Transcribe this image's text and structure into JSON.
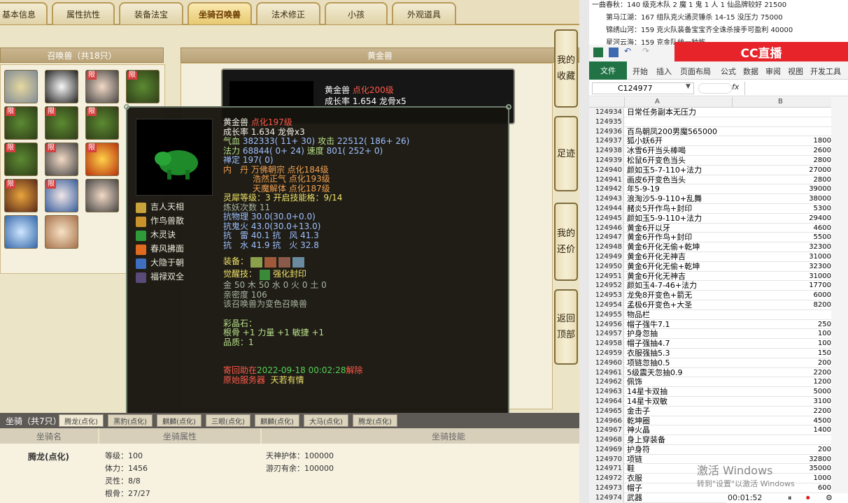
{
  "game": {
    "tabs": [
      "基本信息",
      "属性抗性",
      "装备法宝",
      "坐骑召唤兽",
      "法术修正",
      "小孩",
      "外观道具"
    ],
    "summon_list_title": "召唤兽（共18只）",
    "limited_badge": "限",
    "detail_title": "黄金兽",
    "card": {
      "name": "黄金兽",
      "level": "点化200级",
      "growth": "成长率 1.654 龙骨x5"
    },
    "popup": {
      "name": "黄金兽",
      "level": "点化197级",
      "growth": "成长率 1.634 龙骨x3",
      "hp_label": "气血",
      "hp": "382333( 11+ 30)",
      "atk_label": "攻击",
      "atk": "22512( 186+ 26)",
      "mp_label": "法力",
      "mp": "68844( 0+ 24)",
      "spd_label": "速度",
      "spd": "801( 252+ 0)",
      "zen": "禅定 197( 0)",
      "pill_label": "内　丹",
      "pills": [
        "万佛朝宗 点化184级",
        "浩然正气 点化193级",
        "天魔解体 点化187级"
      ],
      "lingxi": "灵犀等级：3 开启技能格：9/14",
      "lianyao": "炼妖次数 11",
      "res_physical": "抗物理 30.0(30.0+0.0)",
      "res_ghost": "抗鬼火 43.0(30.0+13.0)",
      "res_row1": "抗　雷 40.1 抗　风 41.3",
      "res_row2": "抗　水 41.9 抗　火 32.8",
      "equip_label": "装备：",
      "awaken_label": "觉醒技：",
      "awaken_skill": "强化封印",
      "elements": "金 50 木 50 水 0 火 0 土 0",
      "intimacy": "亲密度 106",
      "variant_note": "该召唤兽为变色召唤兽",
      "gem_label": "彩晶石：",
      "gem_values": "根骨 +1 力量 +1 敏捷 +1",
      "quality": "品质：1",
      "trade_prefix": "寄回助在",
      "trade_time": "2022-09-18 00:02:28",
      "trade_suffix": "解除",
      "server_label": "原始服务器",
      "server_name": "天若有情",
      "skills": [
        "吉人天相",
        "作鸟兽散",
        "木灵诀",
        "春风拂面",
        "大隐于朝",
        "福禄双全"
      ]
    },
    "side_buttons": [
      "我的收藏",
      "足迹",
      "我的还价",
      "返回顶部"
    ],
    "mount_title": "坐骑（共7只）",
    "mount_subtabs": [
      "腾龙(点化)",
      "黑豹(点化)",
      "麒麟(点化)",
      "三眼(点化)",
      "麒麟(点化)",
      "大马(点化)",
      "腾龙(点化)"
    ],
    "mount_headers": [
      "坐骑名",
      "坐骑属性",
      "坐骑技能"
    ],
    "mount": {
      "name": "腾龙(点化)",
      "stats": [
        "等级：100",
        "体力：1456",
        "灵性：8/8",
        "根骨：27/27"
      ],
      "skills": [
        "天神护体：100000",
        "游刃有余：100000"
      ]
    }
  },
  "excel": {
    "notes": [
      "一曲春秋：140 级克木队 2 魔 1 鬼 1 人 1 仙品牌较好 21500",
      "第马江湖：167 组队克火通灵锤杀 14-15 没压力 75000",
      "锦绣山河：159 克火队装备宝宝齐全诛杀接手可盈利 40000",
      "星河云海：159 克金队统一种族"
    ],
    "watermark": "CC直播",
    "ribbon_tabs": [
      "文件",
      "开始",
      "插入",
      "页面布局",
      "公式",
      "数据",
      "审阅",
      "视图",
      "开发工具"
    ],
    "name_box": "C124977",
    "fx": "fx",
    "col_a": "A",
    "col_b": "B",
    "rows": [
      [
        "124934",
        "日常任务副本无压力",
        ""
      ],
      [
        "124935",
        "",
        ""
      ],
      [
        "124936",
        "百鸟朝凤200男魔565000",
        ""
      ],
      [
        "124937",
        "狐小妖6开",
        "1800"
      ],
      [
        "124938",
        "冰雪6开当头棒喝",
        "2600"
      ],
      [
        "124939",
        "松鼠6开变色当头",
        "2800"
      ],
      [
        "124940",
        "颜如玉5-7-110+法力",
        "27000"
      ],
      [
        "124941",
        "画皮6开变色当头",
        "2800"
      ],
      [
        "124942",
        "年5-9-19",
        "39000"
      ],
      [
        "124943",
        "浪淘沙5-9-110+乱舞",
        "38000"
      ],
      [
        "124944",
        "赭炎5开作鸟+封印",
        "5300"
      ],
      [
        "124945",
        "颜如玉5-9-110+法力",
        "29400"
      ],
      [
        "124946",
        "黄金6开以牙",
        "4600"
      ],
      [
        "124947",
        "黄金6开作鸟+封印",
        "5500"
      ],
      [
        "124948",
        "黄金6开化无偷+乾坤",
        "32300"
      ],
      [
        "124949",
        "黄金6开化无神吉",
        "31000"
      ],
      [
        "124950",
        "黄金6开化无偷+乾坤",
        "32300"
      ],
      [
        "124951",
        "黄金6开化无神吉",
        "31000"
      ],
      [
        "124952",
        "颜如玉4-7-46+法力",
        "17700"
      ],
      [
        "124953",
        "龙免8开变色+箭无",
        "6000"
      ],
      [
        "124954",
        "孟极6开变色+大圣",
        "8200"
      ],
      [
        "124955",
        "物品栏",
        ""
      ],
      [
        "124956",
        "帽子强牛7.1",
        "250"
      ],
      [
        "124957",
        "护身忽抽",
        "100"
      ],
      [
        "124958",
        "帽子强抽4.7",
        "100"
      ],
      [
        "124959",
        "衣服强抽5.3",
        "150"
      ],
      [
        "124960",
        "项链忽抽0.5",
        "200"
      ],
      [
        "124961",
        "5级震天忽抽0.9",
        "2200"
      ],
      [
        "124962",
        "佩饰",
        "1200"
      ],
      [
        "124963",
        "14星卡双抽",
        "5000"
      ],
      [
        "124964",
        "14星卡双敏",
        "3100"
      ],
      [
        "124965",
        "金击子",
        "2200"
      ],
      [
        "124966",
        "乾坤圈",
        "4500"
      ],
      [
        "124967",
        "神火晶",
        "1400"
      ],
      [
        "124968",
        "身上穿装备",
        ""
      ],
      [
        "124969",
        "护身符",
        "200"
      ],
      [
        "124970",
        "项链",
        "32800"
      ],
      [
        "124971",
        "鞋",
        "35000"
      ],
      [
        "124972",
        "衣服",
        "1000"
      ],
      [
        "124973",
        "帽子",
        "600"
      ],
      [
        "124974",
        "武器",
        ""
      ]
    ],
    "activate_line1": "激活 Windows",
    "activate_line2": "转到\"设置\"以激活 Windows",
    "timer": "00:01:52"
  },
  "colors": {
    "accent_red": "#ff5a4a",
    "gold": "#e7c971",
    "excel_green": "#217346",
    "watermark_red": "#e8242b"
  }
}
